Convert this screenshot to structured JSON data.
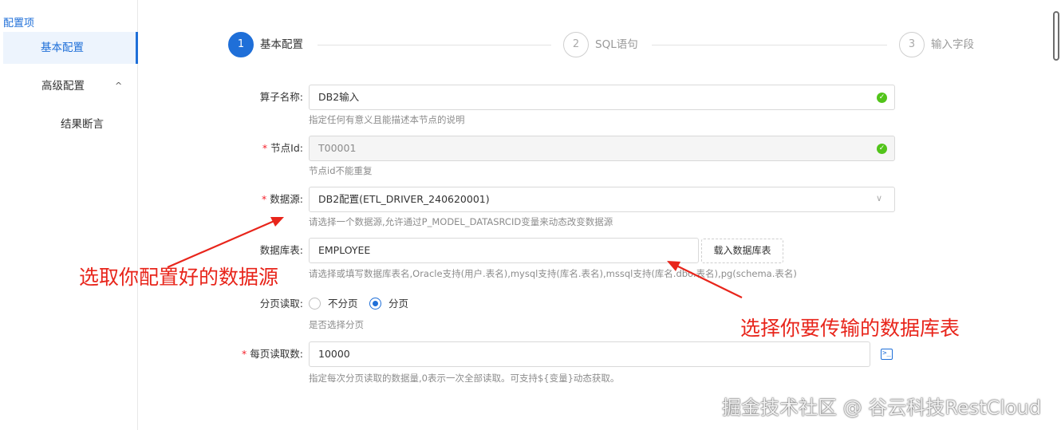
{
  "sidebar": {
    "title": "配置项",
    "items": [
      {
        "label": "基本配置",
        "active": true
      },
      {
        "label": "高级配置",
        "expanded": true
      },
      {
        "label": "结果断言"
      }
    ],
    "caret": "^"
  },
  "steps": [
    {
      "index": "1",
      "label": "基本配置",
      "status": "active"
    },
    {
      "index": "2",
      "label": "SQL语句",
      "status": "wait"
    },
    {
      "index": "3",
      "label": "输入字段",
      "status": "wait"
    }
  ],
  "form": {
    "operator_name": {
      "label": "算子名称:",
      "value": "DB2输入",
      "hint": "指定任何有意义且能描述本节点的说明",
      "valid": true
    },
    "node_id": {
      "label": "节点Id:",
      "required": true,
      "value": "T00001",
      "hint": "节点id不能重复",
      "disabled": true,
      "valid": true
    },
    "datasource": {
      "label": "数据源:",
      "required": true,
      "value": "DB2配置(ETL_DRIVER_240620001)",
      "hint": "请选择一个数据源,允许通过P_MODEL_DATASRCID变量来动态改变数据源"
    },
    "table": {
      "label": "数据库表:",
      "value": "EMPLOYEE",
      "button": "载入数据库表",
      "hint": "请选择或填写数据库表名,Oracle支持(用户.表名),mysql支持(库名.表名),mssql支持(库名.dbo.表名),pg(schema.表名)"
    },
    "paging": {
      "label": "分页读取:",
      "options": [
        "不分页",
        "分页"
      ],
      "selected": "分页",
      "hint": "是否选择分页"
    },
    "page_size": {
      "label": "每页读取数:",
      "required": true,
      "value": "10000",
      "hint": "指定每次分页读取的数据量,0表示一次全部读取。可支持${变量}动态获取。"
    }
  },
  "annotations": {
    "datasource_note": "选取你配置好的数据源",
    "table_note": "选择你要传输的数据库表",
    "color": "#e8251b"
  },
  "watermark": "掘金技术社区 @ 谷云科技RestCloud",
  "colors": {
    "primary": "#1f6fd8",
    "success": "#52c41a",
    "required": "#f5222d"
  },
  "icons": {
    "valid": "check-circle-icon",
    "select": "chevron-down-icon",
    "terminal": "terminal-icon",
    "caret": "chevron-up-icon"
  },
  "glyphs": {
    "check": "✓",
    "chevron": "∨",
    "required": "*",
    "terminal": ">_"
  }
}
